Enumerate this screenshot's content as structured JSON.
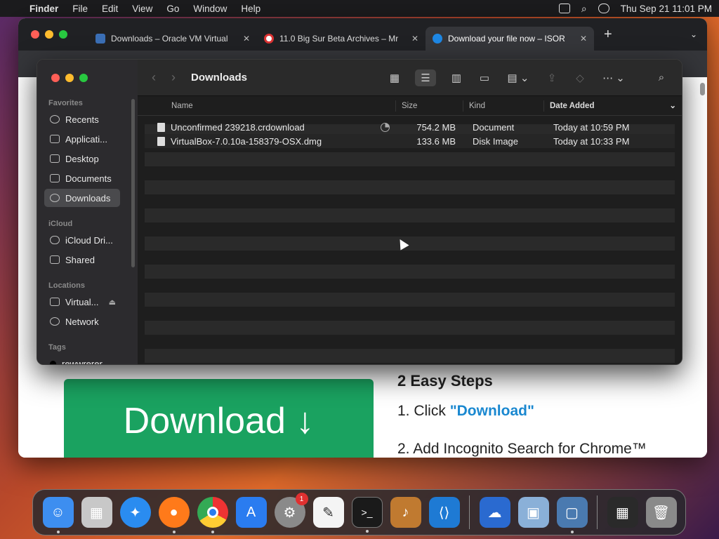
{
  "menubar": {
    "app": "Finder",
    "items": [
      "File",
      "Edit",
      "View",
      "Go",
      "Window",
      "Help"
    ],
    "clock": "Thu Sep 21  11:01 PM"
  },
  "browser": {
    "tabs": [
      {
        "label": "Downloads – Oracle VM Virtual",
        "favicon_color": "#3b6fb6"
      },
      {
        "label": "11.0 Big Sur Beta Archives – Mr",
        "favicon_color": "#d33"
      },
      {
        "label": "Download your file now – ISOR",
        "favicon_color": "#1e88e5"
      }
    ],
    "page": {
      "download_button": "Download ↓",
      "steps_title": "2 Easy Steps",
      "step1_prefix": "1. Click ",
      "step1_link": "\"Download\"",
      "step2": "2. Add Incognito Search for Chrome™"
    }
  },
  "finder": {
    "title": "Downloads",
    "sidebar": {
      "favorites_label": "Favorites",
      "favorites": [
        "Recents",
        "Applicati...",
        "Desktop",
        "Documents",
        "Downloads"
      ],
      "icloud_label": "iCloud",
      "icloud": [
        "iCloud Dri...",
        "Shared"
      ],
      "locations_label": "Locations",
      "locations": [
        "Virtual...",
        "Network"
      ],
      "tags_label": "Tags",
      "tags": [
        "rewwrerer"
      ]
    },
    "columns": {
      "name": "Name",
      "size": "Size",
      "kind": "Kind",
      "date": "Date Added"
    },
    "files": [
      {
        "name": "Unconfirmed 239218.crdownload",
        "size": "754.2 MB",
        "kind": "Document",
        "date": "Today at 10:59 PM"
      },
      {
        "name": "VirtualBox-7.0.10a-158379-OSX.dmg",
        "size": "133.6 MB",
        "kind": "Disk Image",
        "date": "Today at 10:33 PM"
      }
    ]
  },
  "dock": {
    "apps": [
      {
        "name": "Finder",
        "color": "#3d8ef0"
      },
      {
        "name": "Launchpad",
        "color": "#c8c8c8"
      },
      {
        "name": "Safari",
        "color": "#2a8cf0"
      },
      {
        "name": "Firefox",
        "color": "#ff7a1a"
      },
      {
        "name": "Chrome",
        "color": "#e8e8e8"
      },
      {
        "name": "App Store",
        "color": "#2a7cf0"
      },
      {
        "name": "System Settings",
        "color": "#8a8a8a",
        "badge": "1"
      },
      {
        "name": "TextEdit",
        "color": "#f4f4f4"
      },
      {
        "name": "Terminal",
        "color": "#1a1a1a"
      },
      {
        "name": "GarageBand",
        "color": "#c07a30"
      },
      {
        "name": "VS Code",
        "color": "#1e7ad4"
      },
      {
        "name": "Weather",
        "color": "#2a6ad0"
      },
      {
        "name": "Preview",
        "color": "#8ab0d8"
      },
      {
        "name": "VirtualBox",
        "color": "#4a7ab0"
      },
      {
        "name": "Window Manager",
        "color": "#2a2a2a"
      },
      {
        "name": "Trash",
        "color": "#8a8a8a"
      }
    ]
  }
}
